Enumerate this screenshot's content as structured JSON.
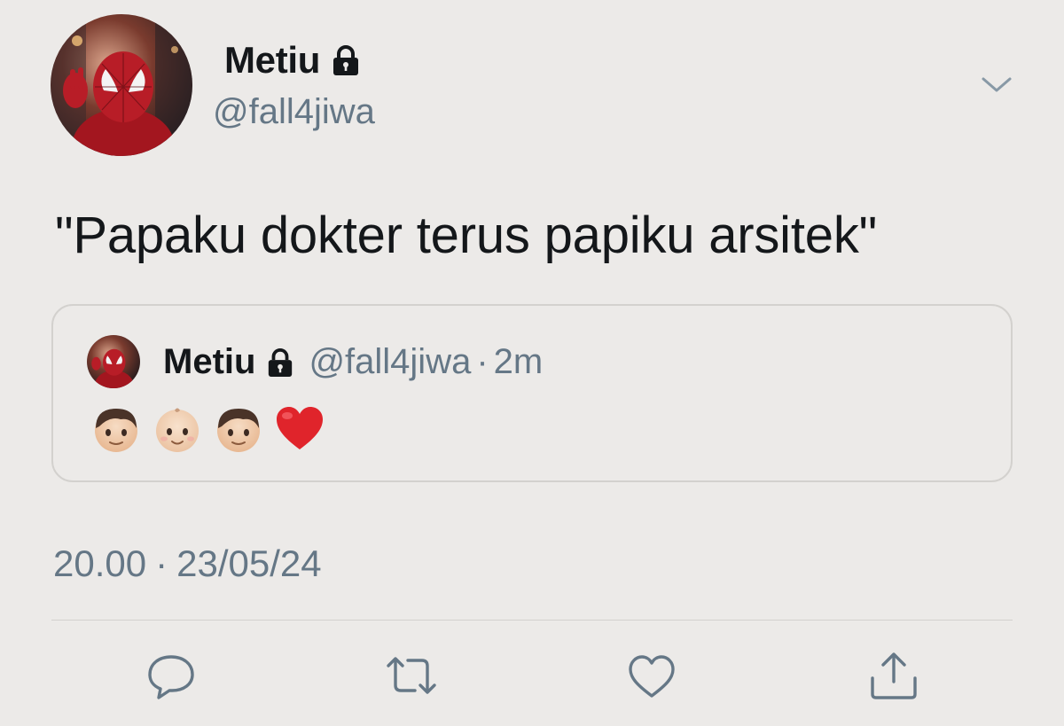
{
  "tweet": {
    "author": {
      "display_name": "Metiu",
      "handle": "@fall4jiwa",
      "protected_icon": "lock-icon",
      "avatar": "spiderman-selfie-avatar"
    },
    "menu_icon": "chevron-down-icon",
    "text": "\"Papaku dokter terus papiku arsitek\"",
    "quote": {
      "display_name": "Metiu",
      "handle": "@fall4jiwa",
      "separator": "·",
      "time_ago": "2m",
      "emojis": [
        "boy-emoji",
        "baby-emoji",
        "boy-emoji",
        "red-heart-emoji"
      ]
    },
    "timestamp": {
      "time": "20.00",
      "separator": "·",
      "date": "23/05/24"
    },
    "actions": [
      "reply-icon",
      "retweet-icon",
      "like-icon",
      "share-icon"
    ]
  },
  "colors": {
    "background": "#ECEAE8",
    "primary_text": "#14171A",
    "secondary_text": "#657786",
    "border": "#D3D1CE",
    "icon": "#657786",
    "heart": "#E0242B"
  }
}
